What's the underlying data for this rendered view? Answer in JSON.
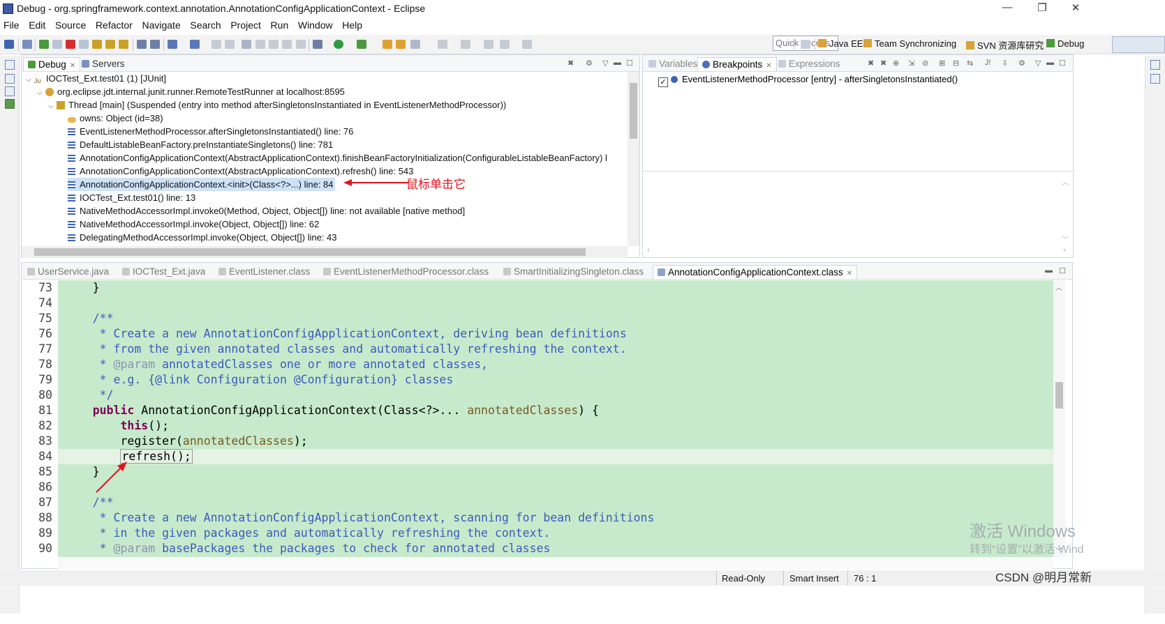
{
  "window": {
    "title": "Debug - org.springframework.context.annotation.AnnotationConfigApplicationContext - Eclipse",
    "minimize": "—",
    "restore": "❐",
    "close": "✕"
  },
  "menu": [
    "File",
    "Edit",
    "Source",
    "Refactor",
    "Navigate",
    "Search",
    "Project",
    "Run",
    "Window",
    "Help"
  ],
  "toolbar": {
    "quick_access_placeholder": "Quick Access",
    "perspectives": [
      "Java EE",
      "Team Synchronizing",
      "SVN 资源库研究",
      "Debug"
    ]
  },
  "debug_view": {
    "tabs": [
      "Debug",
      "Servers"
    ],
    "tree": [
      {
        "text": "IOCTest_Ext.test01 (1) [JUnit]"
      },
      {
        "text": "org.eclipse.jdt.internal.junit.runner.RemoteTestRunner at localhost:8595"
      },
      {
        "text": "Thread [main] (Suspended (entry into method afterSingletonsInstantiated in EventListenerMethodProcessor))"
      },
      {
        "text": "owns: Object  (id=38)"
      },
      {
        "text": "EventListenerMethodProcessor.afterSingletonsInstantiated() line: 76"
      },
      {
        "text": "DefaultListableBeanFactory.preInstantiateSingletons() line: 781"
      },
      {
        "text": "AnnotationConfigApplicationContext(AbstractApplicationContext).finishBeanFactoryInitialization(ConfigurableListableBeanFactory) l"
      },
      {
        "text": "AnnotationConfigApplicationContext(AbstractApplicationContext).refresh() line: 543"
      },
      {
        "text": "AnnotationConfigApplicationContext.<init>(Class<?>...) line: 84"
      },
      {
        "text": "IOCTest_Ext.test01() line: 13"
      },
      {
        "text": "NativeMethodAccessorImpl.invoke0(Method, Object, Object[]) line: not available [native method]"
      },
      {
        "text": "NativeMethodAccessorImpl.invoke(Object, Object[]) line: 62"
      },
      {
        "text": "DelegatingMethodAccessorImpl.invoke(Object, Object[]) line: 43"
      }
    ],
    "annotation": "鼠标单击它"
  },
  "breakpoints_view": {
    "tabs": [
      "Variables",
      "Breakpoints",
      "Expressions"
    ],
    "items": [
      "EventListenerMethodProcessor [entry] - afterSingletonsInstantiated()"
    ]
  },
  "editor": {
    "tabs": [
      "UserService.java",
      "IOCTest_Ext.java",
      "EventListener.class",
      "EventListenerMethodProcessor.class",
      "SmartInitializingSingleton.class",
      "AnnotationConfigApplicationContext.class"
    ],
    "line_numbers": [
      "73",
      "74",
      "75",
      "76",
      "77",
      "78",
      "79",
      "80",
      "81",
      "82",
      "83",
      "84",
      "85",
      "86",
      "87",
      "88",
      "89",
      "90"
    ],
    "code": {
      "l73": "    }",
      "l75": "    /**",
      "l76": "     * Create a new AnnotationConfigApplicationContext, deriving bean definitions",
      "l77": "     * from the given annotated classes and automatically refreshing the context.",
      "l78a": "     * ",
      "l78tag": "@param",
      "l78b": " annotatedClasses one or more annotated classes,",
      "l79": "     * e.g. {@link Configuration @Configuration} classes",
      "l80": "     */",
      "l81kw": "public",
      "l81a": " AnnotationConfigApplicationContext(Class<?>... ",
      "l81p": "annotatedClasses",
      "l81b": ") {",
      "l82kw": "this",
      "l82b": "();",
      "l83a": "register(",
      "l83p": "annotatedClasses",
      "l83b": ");",
      "l84": "refresh();",
      "l85": "    }",
      "l87": "    /**",
      "l88": "     * Create a new AnnotationConfigApplicationContext, scanning for bean definitions",
      "l89": "     * in the given packages and automatically refreshing the context.",
      "l90a": "     * ",
      "l90tag": "@param",
      "l90b": " basePackages the packages to check for annotated classes"
    }
  },
  "statusbar": {
    "mode": "Read-Only",
    "insert": "Smart Insert",
    "position": "76 : 1"
  },
  "overlay": {
    "activate_title": "激活 Windows",
    "activate_sub": "转到“设置”以激活 Wind",
    "credit": "CSDN @明月常新"
  },
  "colors": {
    "code_bg": "#c7eacc",
    "keyword": "#7f0055",
    "comment": "#3a5bbd",
    "annotation_red": "#e0141e",
    "selection": "#cfe2f7"
  }
}
